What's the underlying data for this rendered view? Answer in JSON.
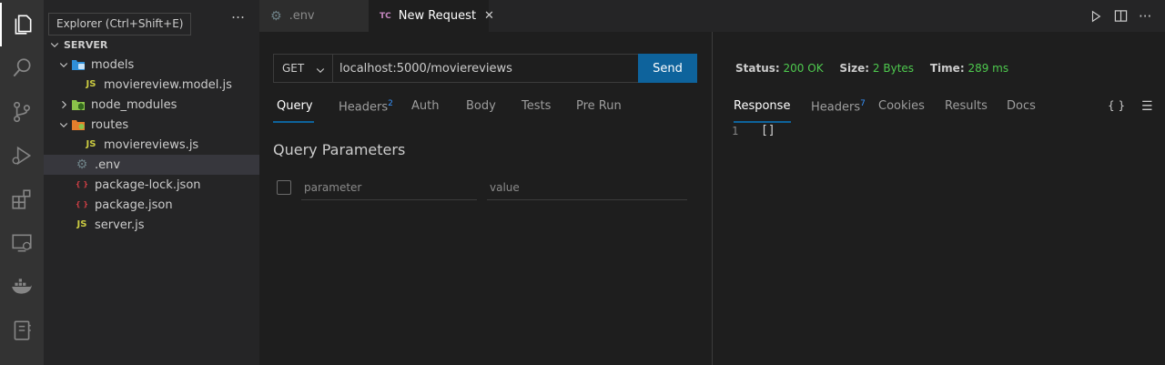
{
  "activity_bar": {
    "items": [
      {
        "icon": "files-icon",
        "active": true
      },
      {
        "icon": "search-icon"
      },
      {
        "icon": "source-control-icon"
      },
      {
        "icon": "run-debug-icon"
      },
      {
        "icon": "extensions-icon"
      },
      {
        "icon": "remote-explorer-icon"
      },
      {
        "icon": "docker-icon"
      },
      {
        "icon": "notebook-icon"
      }
    ],
    "tooltip": "Explorer (Ctrl+Shift+E)"
  },
  "explorer": {
    "more_icon": "…",
    "root": "SERVER",
    "rows": [
      {
        "label": "models",
        "icon": "folder-models-icon"
      },
      {
        "label": "moviereview.model.js",
        "icon_text": "JS"
      },
      {
        "label": "node_modules",
        "icon": "folder-node-icon"
      },
      {
        "label": "routes",
        "icon": "folder-routes-icon"
      },
      {
        "label": "moviereviews.js",
        "icon_text": "JS"
      },
      {
        "label": ".env",
        "icon": "gear-icon"
      },
      {
        "label": "package-lock.json",
        "icon_text": "{ }"
      },
      {
        "label": "package.json",
        "icon_text": "{ }"
      },
      {
        "label": "server.js",
        "icon_text": "JS"
      }
    ]
  },
  "tabs": {
    "env_label": ".env",
    "request_badge": "TC",
    "request_label": "New Request",
    "close_glyph": "✕"
  },
  "request": {
    "method": "GET",
    "url": "localhost:5000/moviereviews",
    "send_label": "Send",
    "tabs": [
      {
        "label": "Query"
      },
      {
        "label": "Headers",
        "count": "2"
      },
      {
        "label": "Auth"
      },
      {
        "label": "Body"
      },
      {
        "label": "Tests"
      },
      {
        "label": "Pre Run"
      }
    ],
    "query_title": "Query Parameters",
    "param_placeholder": "parameter",
    "value_placeholder": "value"
  },
  "response": {
    "status_label": "Status:",
    "status_value": "200 OK",
    "size_label": "Size:",
    "size_value": "2 Bytes",
    "time_label": "Time:",
    "time_value": "289 ms",
    "tabs": [
      {
        "label": "Response"
      },
      {
        "label": "Headers",
        "count": "7"
      },
      {
        "label": "Cookies"
      },
      {
        "label": "Results"
      },
      {
        "label": "Docs"
      }
    ],
    "format_glyph": "{ }",
    "menu_glyph": "☰",
    "line_number": "1",
    "body": "[]"
  },
  "colors": {
    "accent": "#0e639c",
    "success": "#4ec94e",
    "badge": "#3794ff"
  }
}
